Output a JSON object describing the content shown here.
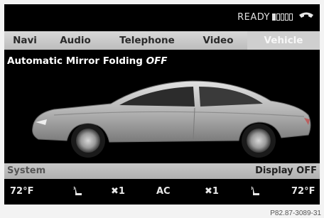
{
  "status": {
    "ready_label": "READY",
    "signal_bars_on": 1,
    "signal_bars_total": 5,
    "phone_icon": "phone-handset-icon"
  },
  "tabs": [
    {
      "label": "Navi",
      "active": false
    },
    {
      "label": "Audio",
      "active": false
    },
    {
      "label": "Telephone",
      "active": false
    },
    {
      "label": "Video",
      "active": false
    },
    {
      "label": "Vehicle",
      "active": true
    }
  ],
  "main": {
    "title_prefix": "Automatic Mirror Folding",
    "title_value": "OFF"
  },
  "bottom": {
    "system_label": "System",
    "display_label": "Display OFF"
  },
  "climate": {
    "left_temp": "72°F",
    "left_seat_icon": "seat-heat-icon",
    "left_fan": "✖1",
    "ac": "AC",
    "right_fan": "✖1",
    "right_seat_icon": "seat-heat-icon",
    "right_temp": "72°F"
  },
  "caption": "P82.87-3089-31",
  "colors": {
    "screen_bg": "#000000",
    "tab_bar": "#c4c4c4",
    "active_tab_text": "#f7f7f7",
    "car_silver": "#b9b9b9"
  }
}
